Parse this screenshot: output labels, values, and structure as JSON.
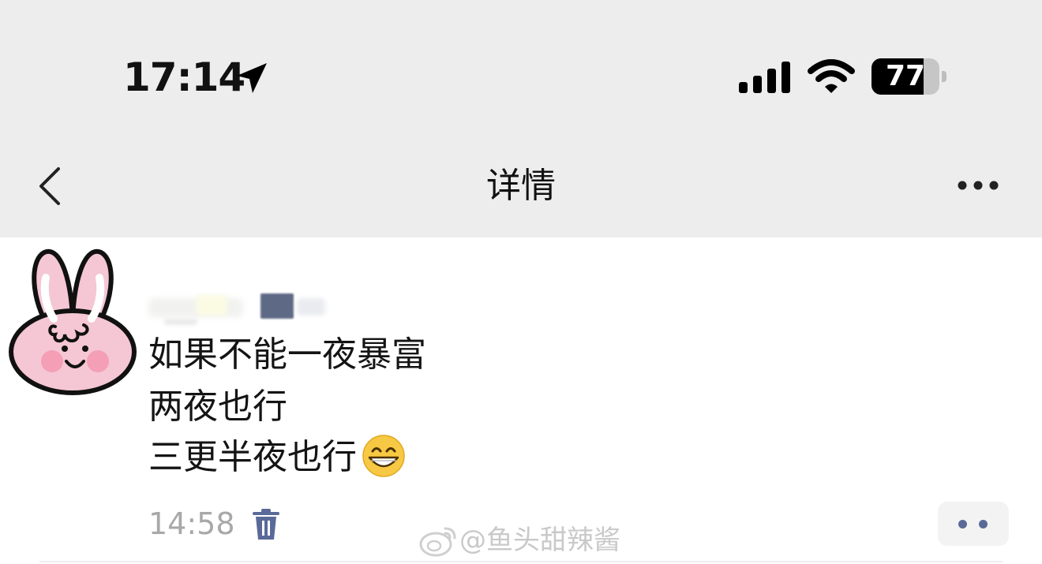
{
  "status_bar": {
    "time": "17:14",
    "battery_level": "77",
    "battery_fraction": 0.77,
    "icons": [
      "location-arrow-icon",
      "cellular-signal-icon",
      "wifi-icon",
      "battery-icon"
    ]
  },
  "nav": {
    "title": "详情",
    "back_icon": "chevron-left-icon",
    "more_icon": "more-horizontal-icon"
  },
  "post": {
    "avatar": "pink-bunny-avatar",
    "lines": [
      "如果不能一夜暴富",
      "两夜也行",
      "三更半夜也行"
    ],
    "emoji": "grinning-face-icon",
    "time": "14:58",
    "delete_icon": "trash-icon",
    "action_icon": "more-dots-icon"
  },
  "watermark": {
    "text": "@鱼头甜辣酱"
  },
  "colors": {
    "header_bg": "#ededed",
    "page_bg": "#ffffff",
    "accent": "#5a6a98",
    "muted_text": "#a8a8a8"
  }
}
